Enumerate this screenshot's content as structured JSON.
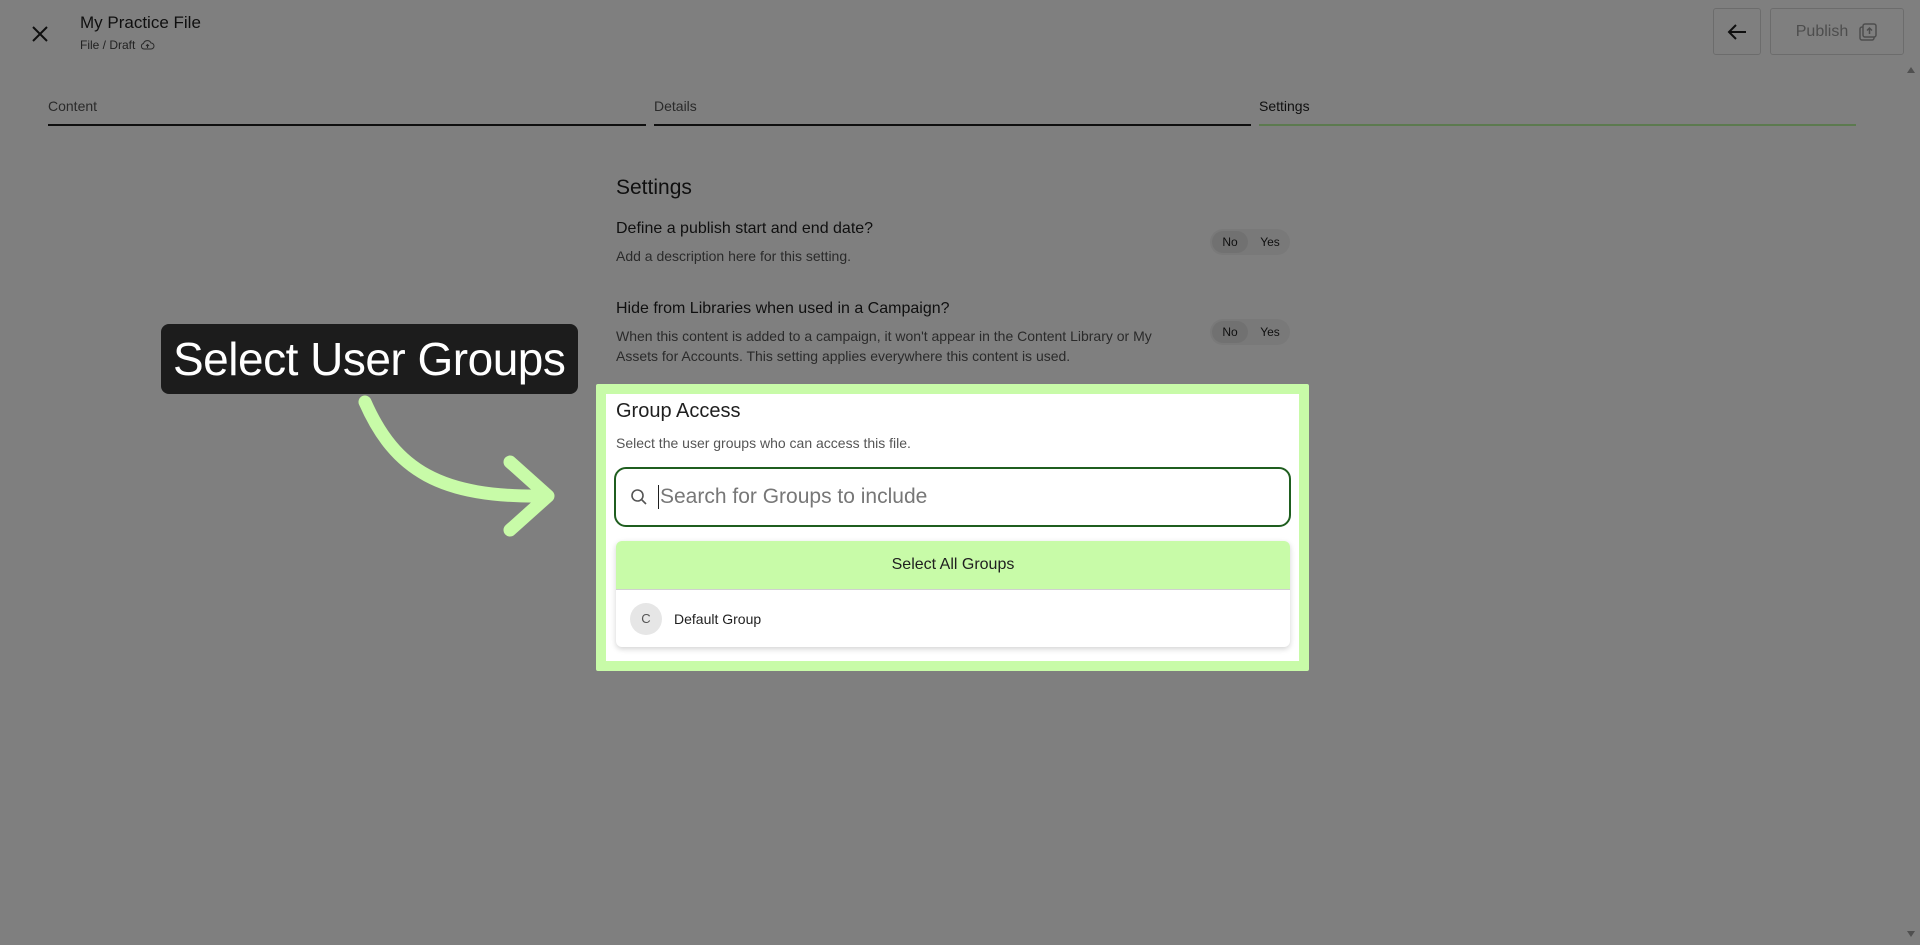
{
  "header": {
    "title": "My Practice File",
    "breadcrumb": "File / Draft",
    "publish_label": "Publish"
  },
  "steps": [
    {
      "label": "Content",
      "active": false
    },
    {
      "label": "Details",
      "active": false
    },
    {
      "label": "Settings",
      "active": true
    }
  ],
  "settings": {
    "title": "Settings",
    "items": [
      {
        "question": "Define a publish start and end date?",
        "description": "Add a description here for this setting.",
        "toggle": {
          "no": "No",
          "yes": "Yes",
          "selected": "No"
        }
      },
      {
        "question": "Hide from Libraries when used in a Campaign?",
        "description": "When this content is added to a campaign, it won't appear in the Content Library or My Assets for Accounts. This setting applies everywhere this content is used.",
        "toggle": {
          "no": "No",
          "yes": "Yes",
          "selected": "No"
        }
      }
    ]
  },
  "group_access": {
    "title": "Group Access",
    "description": "Select the user groups who can access this file.",
    "search_placeholder": "Search for Groups to include",
    "search_value": "",
    "select_all_label": "Select All Groups",
    "groups": [
      {
        "initial": "C",
        "name": "Default Group"
      }
    ]
  },
  "callout": {
    "text": "Select User Groups"
  },
  "colors": {
    "highlight": "#c8fba8",
    "active_step": "#b9f59f",
    "overlay": "rgba(0,0,0,0.5)",
    "callout_bg": "#1c1c1c"
  },
  "icons": {
    "close": "close-icon",
    "cloud": "cloud-upload-icon",
    "back": "arrow-left-icon",
    "publish": "publish-icon",
    "search": "search-icon",
    "arrow": "curved-arrow-icon"
  }
}
